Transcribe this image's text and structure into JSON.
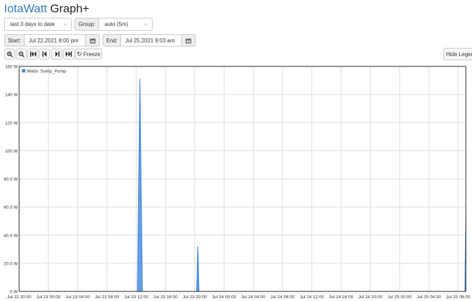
{
  "header": {
    "brand": "IotaWatt",
    "title_rest": " Graph+"
  },
  "controls": {
    "range_select": "last 3 days to date",
    "group_label": "Group:",
    "group_select": "auto (5m)",
    "start_label": "Start:",
    "start_value": "Jul 22,2021 8:00 pm",
    "end_label": "End:",
    "end_value": "Jul 25,2021 9:03 am",
    "freeze_label": "Freeze",
    "hide_legend_label": "Hide Legend"
  },
  "icons": {
    "zoom_in": "zoom-in-icon",
    "zoom_out": "zoom-out-icon",
    "first": "skip-to-start-icon",
    "prev": "step-back-icon",
    "next": "step-forward-icon",
    "last": "skip-to-end-icon",
    "refresh": "refresh-icon",
    "calendar": "calendar-icon"
  },
  "colors": {
    "series": "#4a8fe3",
    "brand": "#337ab7"
  },
  "chart_data": {
    "type": "area",
    "ylim": [
      0,
      160
    ],
    "y_ticks": [
      "0 W",
      "20.0 W",
      "40.0 W",
      "60.0 W",
      "80.0 W",
      "100 W",
      "120 W",
      "140 W",
      "160 W"
    ],
    "x_ticks": [
      "Jul 22 20:00",
      "Jul 23 00:00",
      "Jul 23 04:00",
      "Jul 23 08:00",
      "Jul 23 12:00",
      "Jul 23 16:00",
      "Jul 23 20:00",
      "Jul 24 00:00",
      "Jul 24 04:00",
      "Jul 24 08:00",
      "Jul 24 12:00",
      "Jul 24 16:00",
      "Jul 24 20:00",
      "Jul 25 00:00",
      "Jul 25 04:00",
      "Jul 25 08:00"
    ],
    "x_range": [
      "Jul 22 20:00",
      "Jul 25 09:03"
    ],
    "grid": true,
    "legend_position": "top-left",
    "series": [
      {
        "name": "Watts: Sump_Pump",
        "points": [
          [
            "Jul 22 20:00",
            0
          ],
          [
            "Jul 23 12:10",
            0
          ],
          [
            "Jul 23 12:30",
            151
          ],
          [
            "Jul 23 12:50",
            0
          ],
          [
            "Jul 23 20:15",
            0
          ],
          [
            "Jul 23 20:25",
            32
          ],
          [
            "Jul 23 20:35",
            0
          ],
          [
            "Jul 25 08:55",
            0
          ],
          [
            "Jul 25 09:03",
            55
          ]
        ]
      }
    ]
  }
}
